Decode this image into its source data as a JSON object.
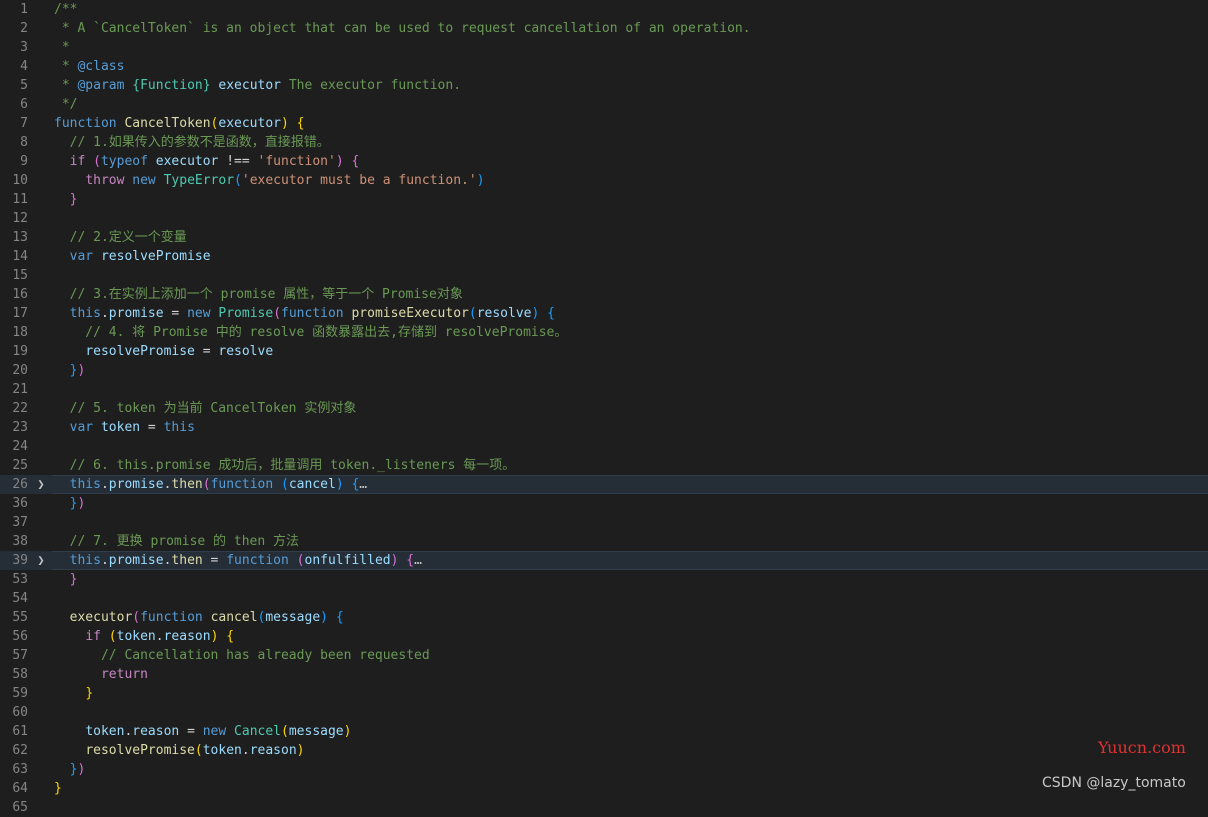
{
  "editor": {
    "lines": [
      {
        "n": "1",
        "tokens": [
          [
            "/**",
            "comment"
          ]
        ]
      },
      {
        "n": "2",
        "tokens": [
          [
            " * A `CancelToken` is an object that can be used to request cancellation of an operation.",
            "comment"
          ]
        ]
      },
      {
        "n": "3",
        "tokens": [
          [
            " *",
            "comment"
          ]
        ]
      },
      {
        "n": "4",
        "tokens": [
          [
            " * ",
            "comment"
          ],
          [
            "@class",
            "keyword"
          ]
        ]
      },
      {
        "n": "5",
        "tokens": [
          [
            " * ",
            "comment"
          ],
          [
            "@param",
            "keyword"
          ],
          [
            " ",
            "comment"
          ],
          [
            "{Function}",
            "class"
          ],
          [
            " ",
            "comment"
          ],
          [
            "executor",
            "ident"
          ],
          [
            " The executor function.",
            "comment"
          ]
        ]
      },
      {
        "n": "6",
        "tokens": [
          [
            " */",
            "comment"
          ]
        ]
      },
      {
        "n": "7",
        "tokens": [
          [
            "function",
            "keyword"
          ],
          [
            " ",
            "plain"
          ],
          [
            "CancelToken",
            "func"
          ],
          [
            "(",
            "brace1"
          ],
          [
            "executor",
            "ident"
          ],
          [
            ")",
            "brace1"
          ],
          [
            " ",
            "plain"
          ],
          [
            "{",
            "brace1"
          ]
        ]
      },
      {
        "n": "8",
        "tokens": [
          [
            "  // 1.如果传入的参数不是函数，直接报错。",
            "comment"
          ]
        ]
      },
      {
        "n": "9",
        "tokens": [
          [
            "  ",
            "plain"
          ],
          [
            "if",
            "control"
          ],
          [
            " ",
            "plain"
          ],
          [
            "(",
            "brace2"
          ],
          [
            "typeof",
            "keyword"
          ],
          [
            " ",
            "plain"
          ],
          [
            "executor",
            "ident"
          ],
          [
            " !== ",
            "plain"
          ],
          [
            "'function'",
            "string"
          ],
          [
            ")",
            "brace2"
          ],
          [
            " ",
            "plain"
          ],
          [
            "{",
            "brace2"
          ]
        ]
      },
      {
        "n": "10",
        "tokens": [
          [
            "    ",
            "plain"
          ],
          [
            "throw",
            "control"
          ],
          [
            " ",
            "plain"
          ],
          [
            "new",
            "keyword"
          ],
          [
            " ",
            "plain"
          ],
          [
            "TypeError",
            "class"
          ],
          [
            "(",
            "brace3"
          ],
          [
            "'executor must be a function.'",
            "string"
          ],
          [
            ")",
            "brace3"
          ]
        ]
      },
      {
        "n": "11",
        "tokens": [
          [
            "  ",
            "plain"
          ],
          [
            "}",
            "brace2"
          ]
        ]
      },
      {
        "n": "12",
        "tokens": []
      },
      {
        "n": "13",
        "tokens": [
          [
            "  // 2.定义一个变量",
            "comment"
          ]
        ]
      },
      {
        "n": "14",
        "tokens": [
          [
            "  ",
            "plain"
          ],
          [
            "var",
            "keyword"
          ],
          [
            " ",
            "plain"
          ],
          [
            "resolvePromise",
            "ident"
          ]
        ]
      },
      {
        "n": "15",
        "tokens": []
      },
      {
        "n": "16",
        "tokens": [
          [
            "  // 3.在实例上添加一个 promise 属性，等于一个 Promise对象",
            "comment"
          ]
        ]
      },
      {
        "n": "17",
        "tokens": [
          [
            "  ",
            "plain"
          ],
          [
            "this",
            "keyword"
          ],
          [
            ".",
            "plain"
          ],
          [
            "promise",
            "ident"
          ],
          [
            " = ",
            "plain"
          ],
          [
            "new",
            "keyword"
          ],
          [
            " ",
            "plain"
          ],
          [
            "Promise",
            "class"
          ],
          [
            "(",
            "brace2"
          ],
          [
            "function",
            "keyword"
          ],
          [
            " ",
            "plain"
          ],
          [
            "promiseExecutor",
            "func"
          ],
          [
            "(",
            "brace3"
          ],
          [
            "resolve",
            "ident"
          ],
          [
            ")",
            "brace3"
          ],
          [
            " ",
            "plain"
          ],
          [
            "{",
            "brace3"
          ]
        ]
      },
      {
        "n": "18",
        "tokens": [
          [
            "    // 4. 将 Promise 中的 resolve 函数暴露出去,存储到 resolvePromise。",
            "comment"
          ]
        ]
      },
      {
        "n": "19",
        "tokens": [
          [
            "    ",
            "plain"
          ],
          [
            "resolvePromise",
            "ident"
          ],
          [
            " = ",
            "plain"
          ],
          [
            "resolve",
            "ident"
          ]
        ]
      },
      {
        "n": "20",
        "tokens": [
          [
            "  ",
            "plain"
          ],
          [
            "}",
            "brace3"
          ],
          [
            ")",
            "brace2"
          ]
        ]
      },
      {
        "n": "21",
        "tokens": []
      },
      {
        "n": "22",
        "tokens": [
          [
            "  // 5. token 为当前 CancelToken 实例对象",
            "comment"
          ]
        ]
      },
      {
        "n": "23",
        "tokens": [
          [
            "  ",
            "plain"
          ],
          [
            "var",
            "keyword"
          ],
          [
            " ",
            "plain"
          ],
          [
            "token",
            "ident"
          ],
          [
            " = ",
            "plain"
          ],
          [
            "this",
            "keyword"
          ]
        ]
      },
      {
        "n": "24",
        "tokens": []
      },
      {
        "n": "25",
        "tokens": [
          [
            "  // 6. this.promise 成功后，批量调用 token._listeners 每一项。",
            "comment"
          ]
        ]
      },
      {
        "n": "26",
        "highlight": true,
        "folded": true,
        "tokens": [
          [
            "  ",
            "plain"
          ],
          [
            "this",
            "keyword"
          ],
          [
            ".",
            "plain"
          ],
          [
            "promise",
            "ident"
          ],
          [
            ".",
            "plain"
          ],
          [
            "then",
            "func"
          ],
          [
            "(",
            "brace2"
          ],
          [
            "function",
            "keyword"
          ],
          [
            " ",
            "plain"
          ],
          [
            "(",
            "brace3"
          ],
          [
            "cancel",
            "ident"
          ],
          [
            ")",
            "brace3"
          ],
          [
            " ",
            "plain"
          ],
          [
            "{",
            "brace3"
          ],
          [
            "…",
            "fold"
          ]
        ]
      },
      {
        "n": "36",
        "tokens": [
          [
            "  ",
            "plain"
          ],
          [
            "}",
            "brace3"
          ],
          [
            ")",
            "brace2"
          ]
        ]
      },
      {
        "n": "37",
        "tokens": []
      },
      {
        "n": "38",
        "tokens": [
          [
            "  // 7. 更换 promise 的 then 方法",
            "comment"
          ]
        ]
      },
      {
        "n": "39",
        "highlight": true,
        "folded": true,
        "tokens": [
          [
            "  ",
            "plain"
          ],
          [
            "this",
            "keyword"
          ],
          [
            ".",
            "plain"
          ],
          [
            "promise",
            "ident"
          ],
          [
            ".",
            "plain"
          ],
          [
            "then",
            "func"
          ],
          [
            " = ",
            "plain"
          ],
          [
            "function",
            "keyword"
          ],
          [
            " ",
            "plain"
          ],
          [
            "(",
            "brace2"
          ],
          [
            "onfulfilled",
            "ident"
          ],
          [
            ")",
            "brace2"
          ],
          [
            " ",
            "plain"
          ],
          [
            "{",
            "brace2"
          ],
          [
            "…",
            "fold"
          ]
        ]
      },
      {
        "n": "53",
        "tokens": [
          [
            "  ",
            "plain"
          ],
          [
            "}",
            "brace2"
          ]
        ]
      },
      {
        "n": "54",
        "tokens": []
      },
      {
        "n": "55",
        "tokens": [
          [
            "  ",
            "plain"
          ],
          [
            "executor",
            "func"
          ],
          [
            "(",
            "brace2"
          ],
          [
            "function",
            "keyword"
          ],
          [
            " ",
            "plain"
          ],
          [
            "cancel",
            "func"
          ],
          [
            "(",
            "brace3"
          ],
          [
            "message",
            "ident"
          ],
          [
            ")",
            "brace3"
          ],
          [
            " ",
            "plain"
          ],
          [
            "{",
            "brace3"
          ]
        ]
      },
      {
        "n": "56",
        "tokens": [
          [
            "    ",
            "plain"
          ],
          [
            "if",
            "control"
          ],
          [
            " ",
            "plain"
          ],
          [
            "(",
            "brace1"
          ],
          [
            "token",
            "ident"
          ],
          [
            ".",
            "plain"
          ],
          [
            "reason",
            "ident"
          ],
          [
            ")",
            "brace1"
          ],
          [
            " ",
            "plain"
          ],
          [
            "{",
            "brace1"
          ]
        ]
      },
      {
        "n": "57",
        "tokens": [
          [
            "      // Cancellation has already been requested",
            "comment"
          ]
        ]
      },
      {
        "n": "58",
        "tokens": [
          [
            "      ",
            "plain"
          ],
          [
            "return",
            "control"
          ]
        ]
      },
      {
        "n": "59",
        "tokens": [
          [
            "    ",
            "plain"
          ],
          [
            "}",
            "brace1"
          ]
        ]
      },
      {
        "n": "60",
        "tokens": []
      },
      {
        "n": "61",
        "tokens": [
          [
            "    ",
            "plain"
          ],
          [
            "token",
            "ident"
          ],
          [
            ".",
            "plain"
          ],
          [
            "reason",
            "ident"
          ],
          [
            " = ",
            "plain"
          ],
          [
            "new",
            "keyword"
          ],
          [
            " ",
            "plain"
          ],
          [
            "Cancel",
            "class"
          ],
          [
            "(",
            "brace1"
          ],
          [
            "message",
            "ident"
          ],
          [
            ")",
            "brace1"
          ]
        ]
      },
      {
        "n": "62",
        "tokens": [
          [
            "    ",
            "plain"
          ],
          [
            "resolvePromise",
            "func"
          ],
          [
            "(",
            "brace1"
          ],
          [
            "token",
            "ident"
          ],
          [
            ".",
            "plain"
          ],
          [
            "reason",
            "ident"
          ],
          [
            ")",
            "brace1"
          ]
        ]
      },
      {
        "n": "63",
        "tokens": [
          [
            "  ",
            "plain"
          ],
          [
            "}",
            "brace3"
          ],
          [
            ")",
            "brace2"
          ]
        ]
      },
      {
        "n": "64",
        "tokens": [
          [
            "}",
            "brace1"
          ]
        ]
      },
      {
        "n": "65",
        "tokens": []
      }
    ]
  },
  "watermark": {
    "brand": "Yuucn.com",
    "author": "CSDN @lazy_tomato"
  },
  "icons": {
    "fold": "chevron-right-icon"
  }
}
